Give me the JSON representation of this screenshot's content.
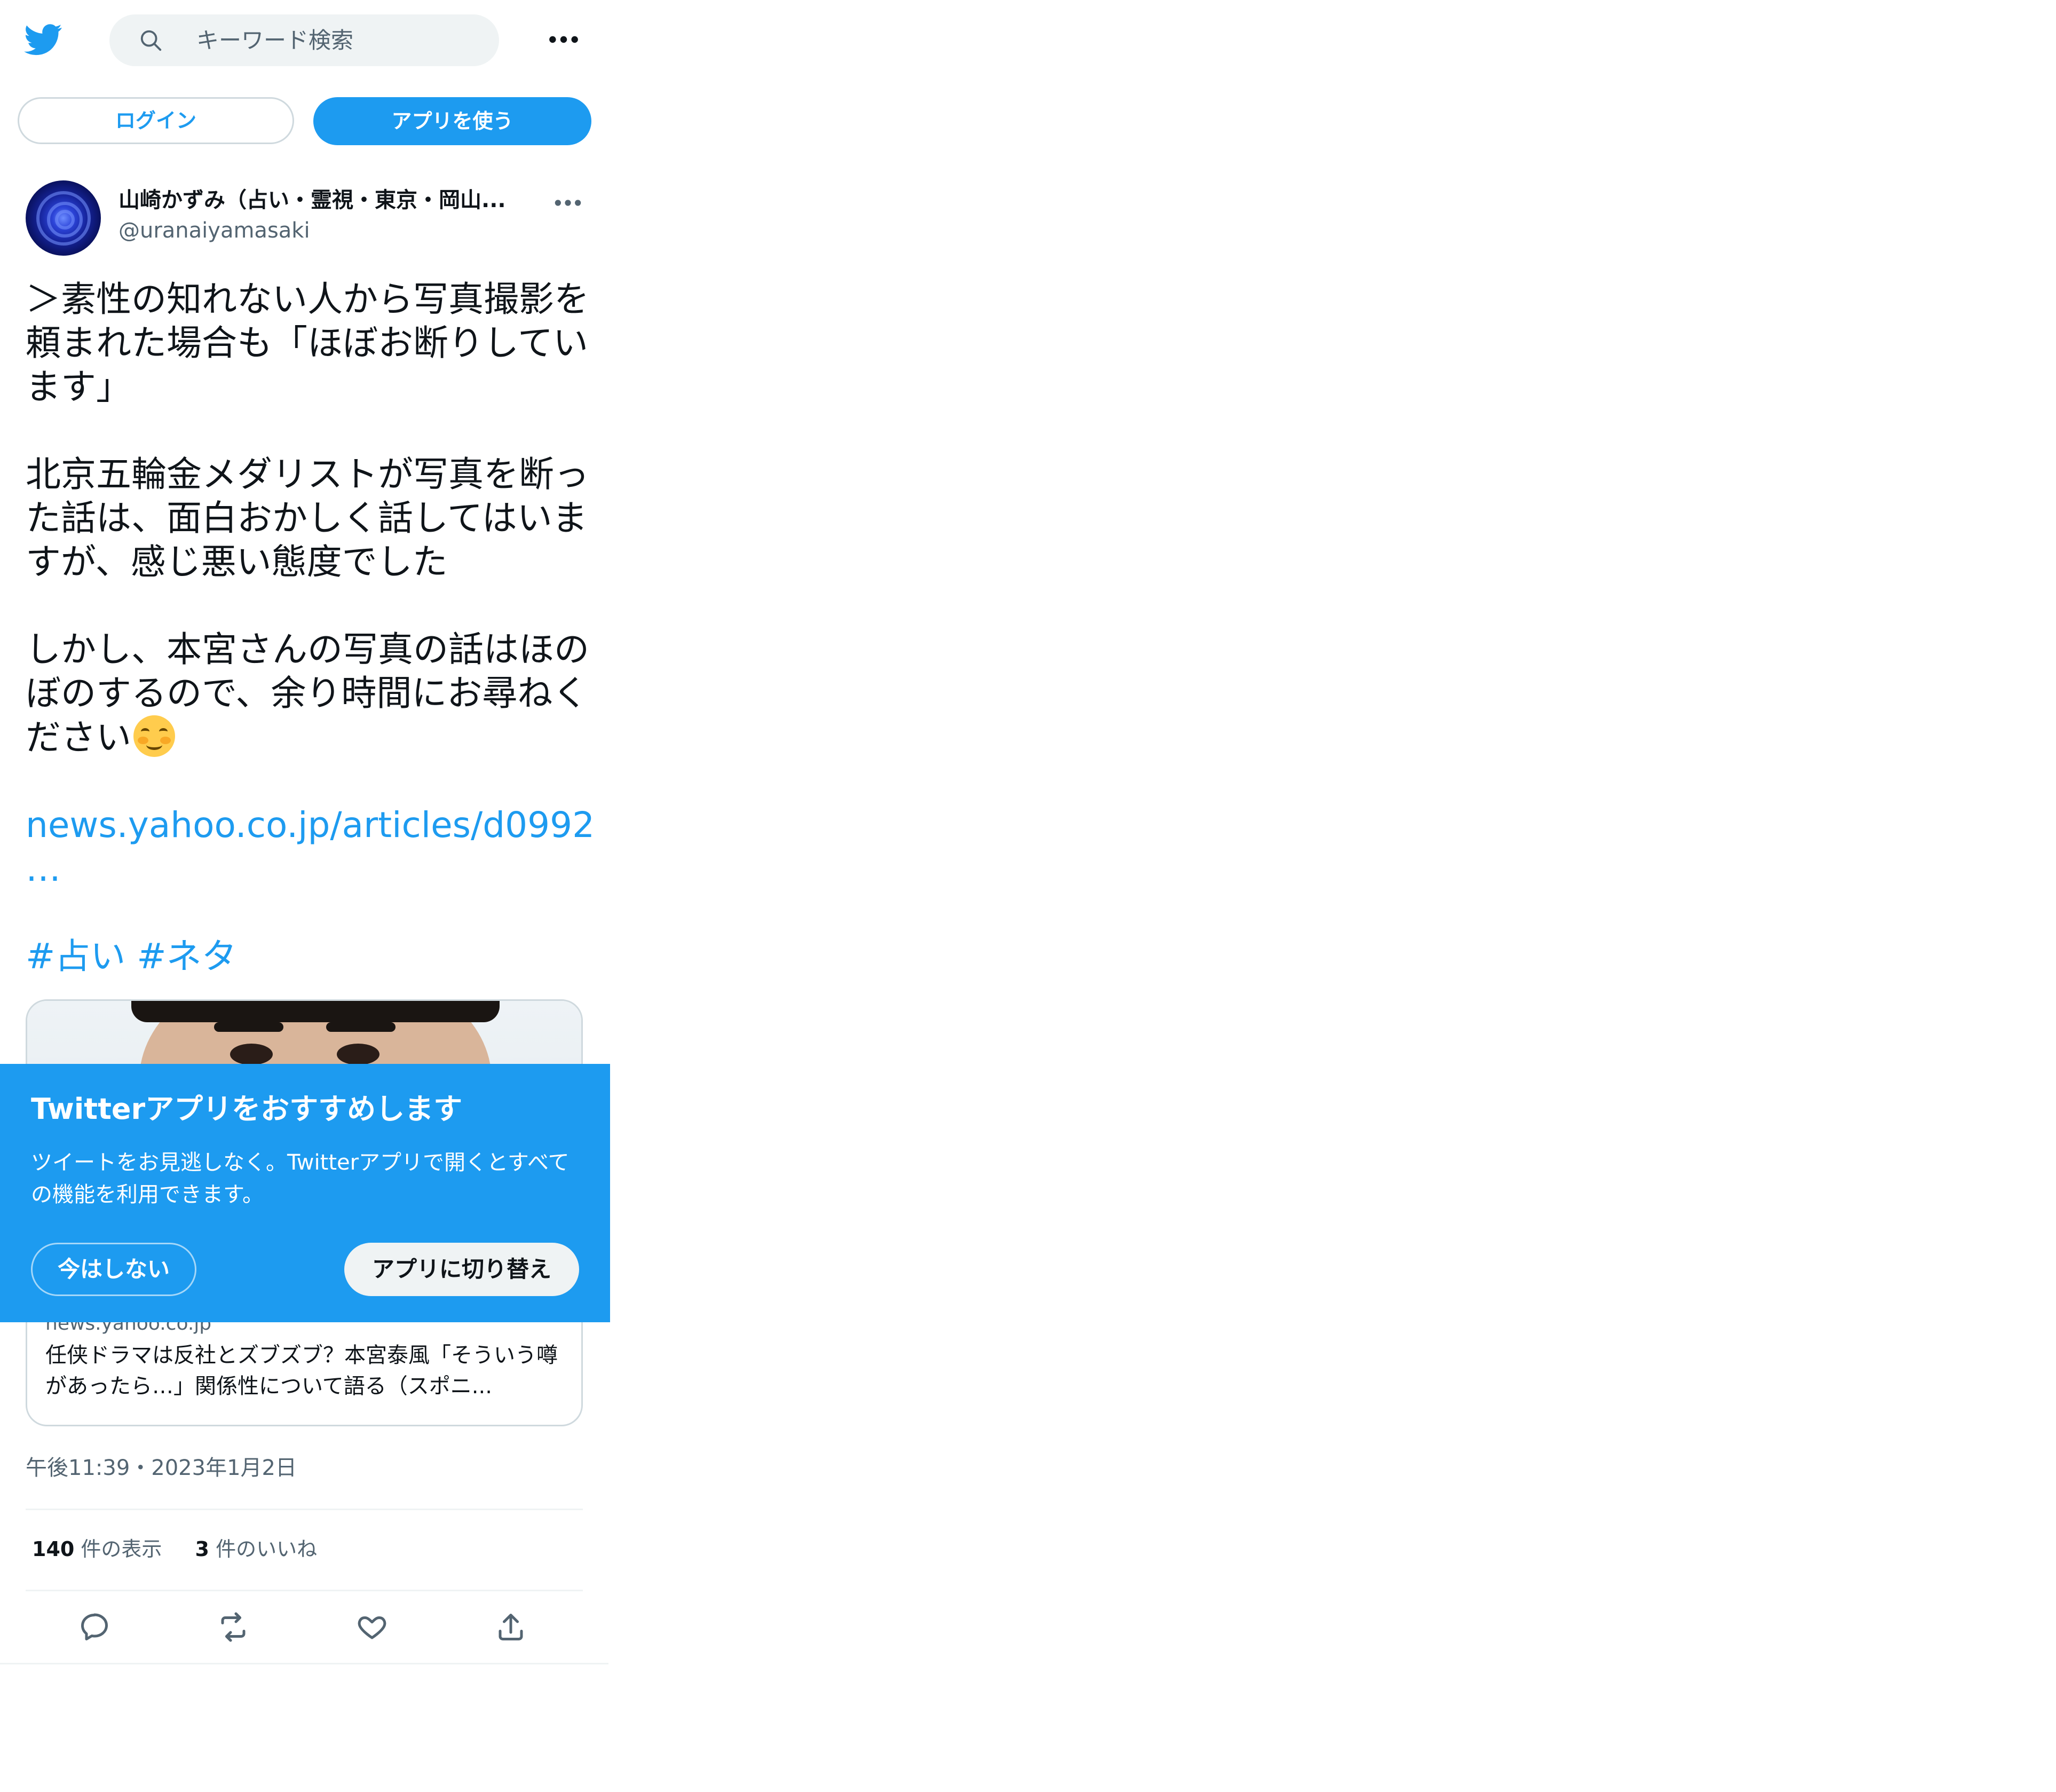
{
  "search": {
    "placeholder": "キーワード検索"
  },
  "auth": {
    "login_label": "ログイン",
    "use_app_label": "アプリを使う"
  },
  "tweet": {
    "author_name": "山崎かずみ（占い・霊視・東京・岡山...",
    "author_handle": "@uranaiyamasaki",
    "paragraph_1": "＞素性の知れない人から写真撮影を頼まれた場合も「ほぼお断りしています」",
    "paragraph_2": "北京五輪金メダリストが写真を断った話は、面白おかしく話してはいますが、感じ悪い態度でした",
    "paragraph_3": "しかし、本宮さんの写真の話はほのぼのするので、余り時間にお尋ねください",
    "link_text": "news.yahoo.co.jp/articles/d0992",
    "link_ellipsis": "…",
    "hashtag_1": "#占い",
    "hashtag_2": "#ネタ",
    "timestamp": "午後11:39・2023年1月2日"
  },
  "card": {
    "domain": "news.yahoo.co.jp",
    "title": "任侠ドラマは反社とズブズブ？本宮泰風「そういう噂があったら…」関係性について語る（スポニ..."
  },
  "stats": {
    "views_count": "140",
    "views_label": "件の表示",
    "likes_count": "3",
    "likes_label": "件のいいね"
  },
  "banner": {
    "title": "Twitterアプリをおすすめします",
    "description": "ツイートをお見逃しなく。Twitterアプリで開くとすべての機能を利用できます。",
    "not_now_label": "今はしない",
    "switch_label": "アプリに切り替え"
  },
  "icons": {
    "logo": "twitter-bird-icon",
    "search": "search-icon",
    "more": "more-horizontal-icon",
    "reply": "reply-icon",
    "retweet": "retweet-icon",
    "like": "heart-icon",
    "share": "share-icon",
    "emoji": "smiling-face-emoji"
  },
  "colors": {
    "accent": "#1d9bf0",
    "text": "#0f1419",
    "secondary": "#536471",
    "border": "#cfd9de"
  }
}
